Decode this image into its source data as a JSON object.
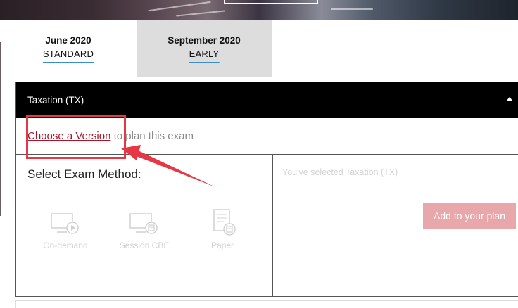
{
  "tabs": [
    {
      "title": "June 2020",
      "subtitle": "STANDARD"
    },
    {
      "title": "September 2020",
      "subtitle": "EARLY"
    }
  ],
  "exam": {
    "header": "Taxation (TX)",
    "choose_link": "Choose a Version",
    "choose_suffix": " to plan this exam",
    "method_title": "Select Exam Method:",
    "methods": [
      "On-demand",
      "Session CBE",
      "Paper"
    ],
    "selected_text": "You've selected Taxation (TX)",
    "add_button": "Add to your plan"
  },
  "colors": {
    "annotation": "#e53744",
    "tab_underline": "#3a8fc7",
    "add_button": "#e7a7ab",
    "link": "#a3182b"
  }
}
